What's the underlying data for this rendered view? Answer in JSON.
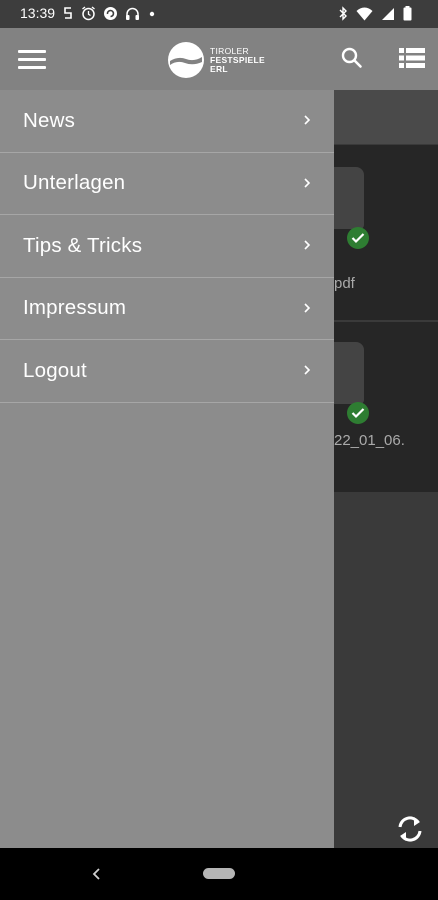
{
  "status_bar": {
    "time": "13:39",
    "icons": [
      "s-notification-icon",
      "alarm-icon",
      "sync-icon",
      "headphones-icon",
      "dot-icon",
      "bluetooth-icon",
      "wifi-icon",
      "signal-icon",
      "battery-icon"
    ]
  },
  "app_bar": {
    "logo": {
      "line1": "TIROLER",
      "line2": "FESTSPIELE",
      "line3": "ERL"
    },
    "icons": [
      "menu-icon",
      "search-icon",
      "list-view-icon"
    ]
  },
  "drawer": {
    "items": [
      {
        "label": "News"
      },
      {
        "label": "Unterlagen"
      },
      {
        "label": "Tips & Tricks"
      },
      {
        "label": "Impressum"
      },
      {
        "label": "Logout"
      }
    ]
  },
  "background": {
    "file1_label": "pdf",
    "file2_label": "22_01_06."
  },
  "colors": {
    "drawer": "#8c8c8c",
    "app_bar": "#828282",
    "check_badge": "#2e7d32"
  }
}
